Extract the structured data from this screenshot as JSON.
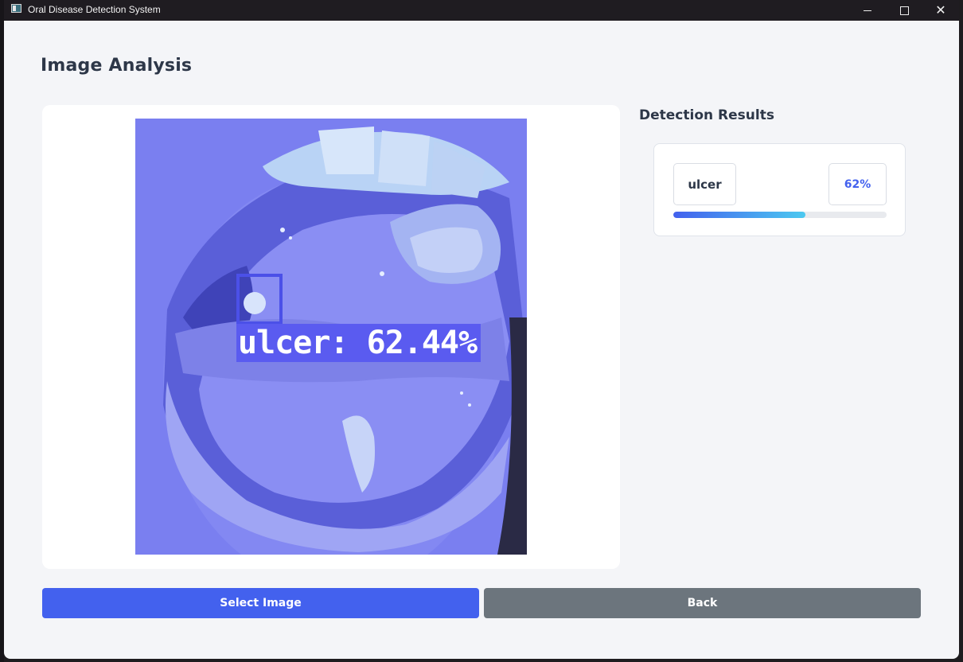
{
  "window": {
    "title": "Oral Disease Detection System",
    "controls": [
      "minimize-icon",
      "maximize-icon",
      "close-icon"
    ]
  },
  "page": {
    "title": "Image Analysis"
  },
  "image": {
    "detection_label": "ulcer: 62.44%"
  },
  "results": {
    "title": "Detection Results",
    "items": [
      {
        "name": "ulcer",
        "confidence_text": "62%",
        "confidence": 0.62
      }
    ]
  },
  "buttons": {
    "select_label": "Select Image",
    "back_label": "Back"
  },
  "colors": {
    "accent": "#4361ee",
    "secondary": "#6c757d",
    "gradient_end": "#4cc9f0",
    "text": "#2d3748",
    "background": "#f4f5f8"
  }
}
